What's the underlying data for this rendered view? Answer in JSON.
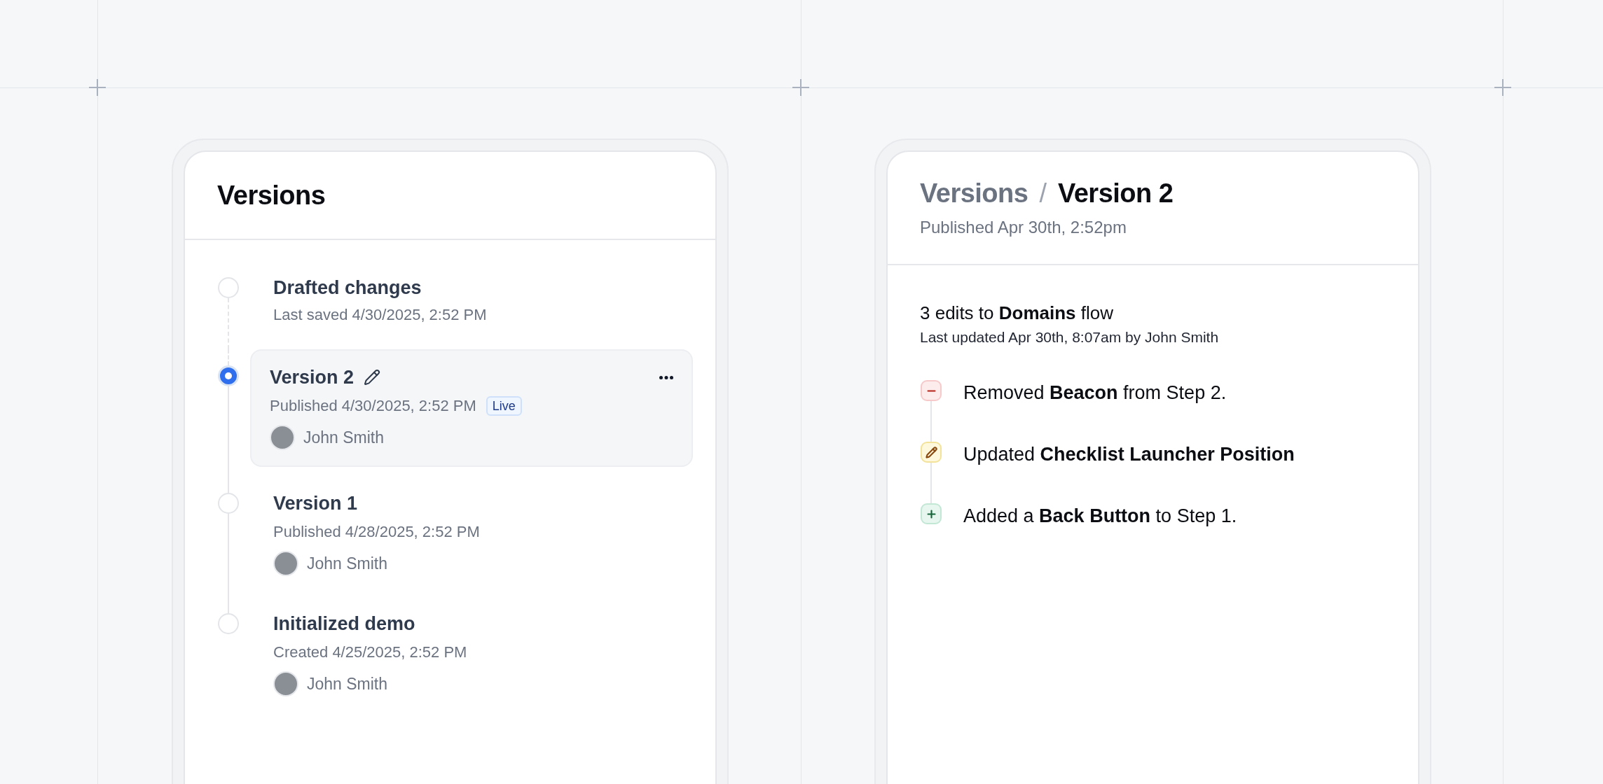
{
  "versions_panel": {
    "title": "Versions",
    "items": [
      {
        "kind": "draft",
        "selected": false,
        "title": "Drafted changes",
        "subtitle": "Last saved 4/30/2025, 2:52 PM"
      },
      {
        "kind": "version",
        "selected": true,
        "title": "Version 2",
        "subtitle": "Published 4/30/2025, 2:52 PM",
        "badge": "Live",
        "author": "John Smith"
      },
      {
        "kind": "version",
        "selected": false,
        "title": "Version 1",
        "subtitle": "Published 4/28/2025, 2:52 PM",
        "author": "John Smith"
      },
      {
        "kind": "version",
        "selected": false,
        "title": "Initialized demo",
        "subtitle": "Created 4/25/2025, 2:52 PM",
        "author": "John Smith"
      }
    ]
  },
  "detail_panel": {
    "breadcrumb": [
      {
        "label": "Versions",
        "current": false
      },
      {
        "label": "Version 2",
        "current": true
      }
    ],
    "separator": "/",
    "subtitle": "Published Apr 30th, 2:52pm",
    "summary": "3 edits to **Domains** flow",
    "updated": "Last updated Apr 30th, 8:07am by John Smith",
    "edits": [
      {
        "kind": "removed",
        "text": "Removed **Beacon** from Step 2."
      },
      {
        "kind": "updated",
        "text": "Updated **Checklist Launcher Position**"
      },
      {
        "kind": "added",
        "text": "Added a **Back Button** to Step 1."
      }
    ]
  }
}
